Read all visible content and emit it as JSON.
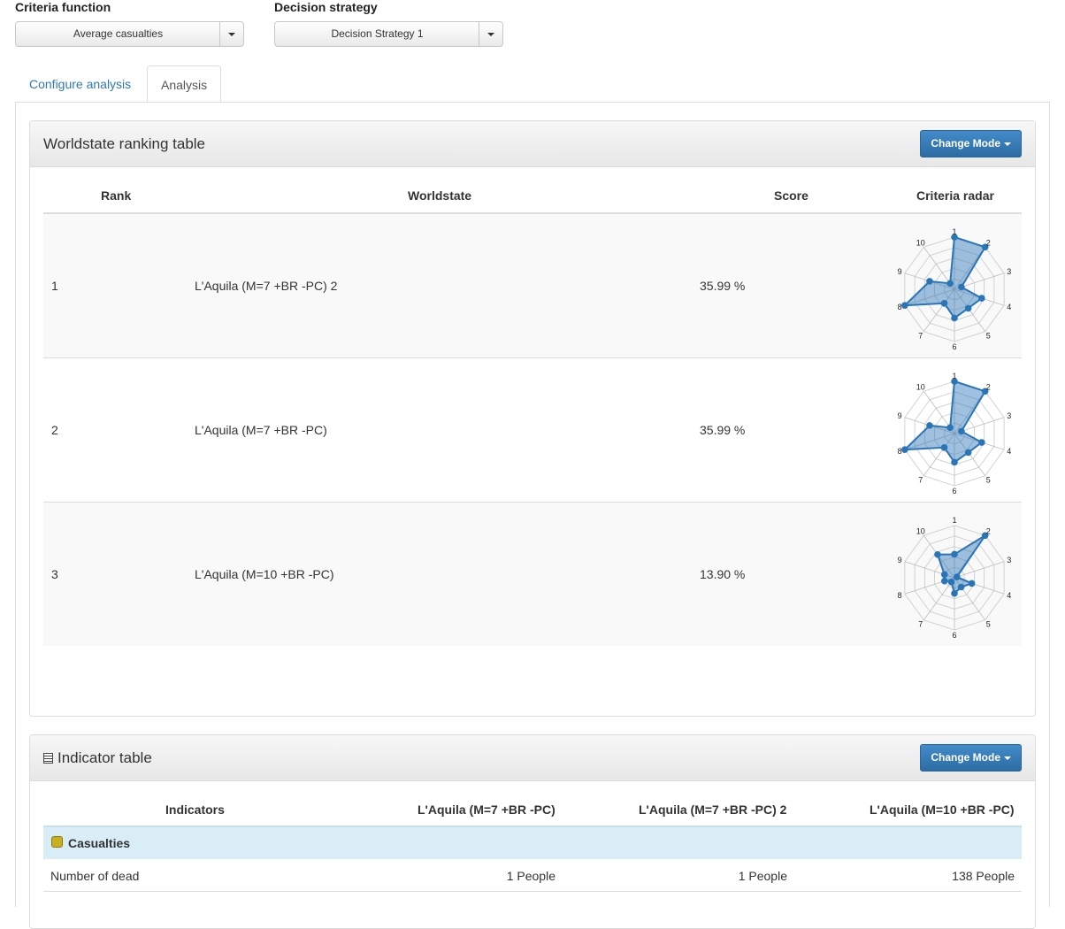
{
  "controls": {
    "criteria_label": "Criteria function",
    "criteria_value": "Average casualties",
    "strategy_label": "Decision strategy",
    "strategy_value": "Decision Strategy 1"
  },
  "tabs": [
    {
      "label": "Configure analysis",
      "active": false
    },
    {
      "label": "Analysis",
      "active": true
    }
  ],
  "ranking_panel": {
    "title": "Worldstate ranking table",
    "change_mode_label": "Change Mode",
    "columns": [
      "Rank",
      "Worldstate",
      "Score",
      "Criteria radar"
    ],
    "rows": [
      {
        "rank": "1",
        "worldstate": "L'Aquila (M=7 +BR -PC) 2",
        "score": "35.99 %"
      },
      {
        "rank": "2",
        "worldstate": "L'Aquila (M=7 +BR -PC)",
        "score": "35.99 %"
      },
      {
        "rank": "3",
        "worldstate": "L'Aquila (M=10 +BR -PC)",
        "score": "13.90 %"
      }
    ]
  },
  "radar": {
    "axis_labels": [
      "1",
      "2",
      "3",
      "4",
      "5",
      "6",
      "7",
      "8",
      "9",
      "10"
    ],
    "series_color": "#2a75b8",
    "chart_data": [
      {
        "type": "radar",
        "rings": 5,
        "values": [
          1.0,
          1.0,
          0.14,
          0.55,
          0.45,
          0.55,
          0.33,
          1.0,
          0.5,
          0.14
        ]
      },
      {
        "type": "radar",
        "rings": 5,
        "values": [
          1.0,
          1.0,
          0.14,
          0.55,
          0.45,
          0.55,
          0.33,
          1.0,
          0.5,
          0.14
        ]
      },
      {
        "type": "radar",
        "rings": 5,
        "values": [
          0.45,
          1.0,
          0.05,
          0.35,
          0.22,
          0.3,
          0.1,
          0.2,
          0.2,
          0.55
        ]
      }
    ]
  },
  "indicator_panel": {
    "title": "Indicator table",
    "change_mode_label": "Change Mode",
    "columns": [
      "Indicators",
      "L'Aquila (M=7 +BR -PC)",
      "L'Aquila (M=7 +BR -PC) 2",
      "L'Aquila (M=10 +BR -PC)"
    ],
    "group": "Casualties",
    "rows": [
      {
        "name": "Number of dead",
        "values": [
          "1 People",
          "1 People",
          "138 People"
        ]
      }
    ]
  },
  "colors": {
    "primary_button": "#3276b1",
    "link": "#3079b8",
    "group_row": "#d9edf7"
  }
}
